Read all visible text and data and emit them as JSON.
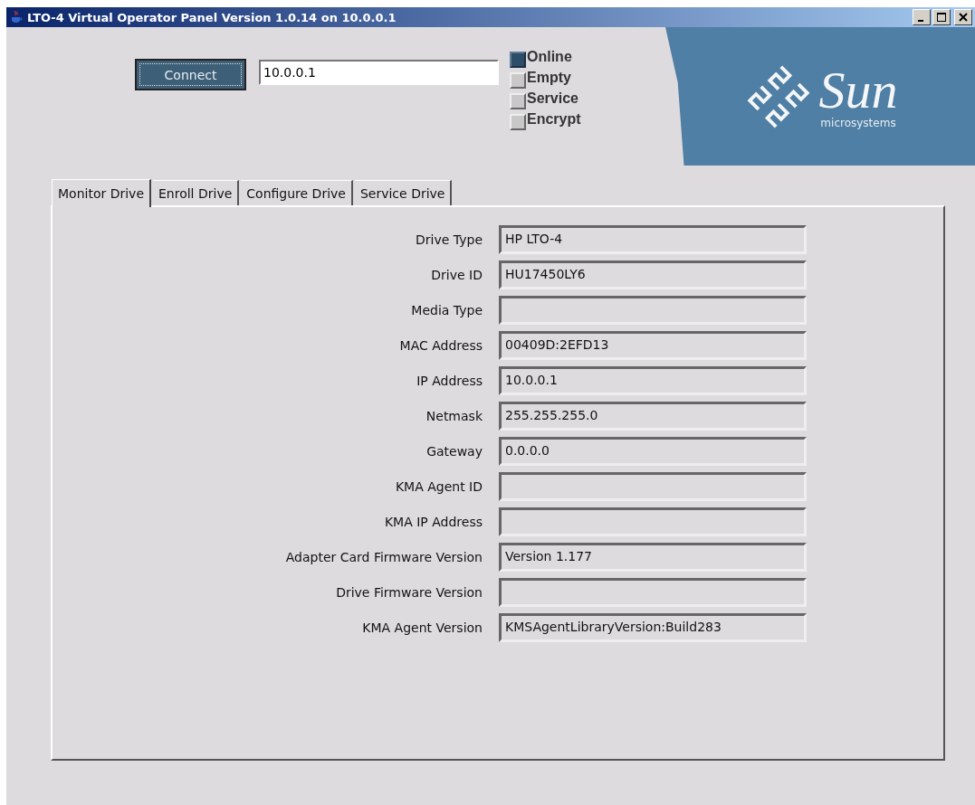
{
  "window": {
    "title": "LTO-4 Virtual Operator Panel Version 1.0.14 on 10.0.0.1"
  },
  "connect": {
    "button": "Connect",
    "address": "10.0.0.1"
  },
  "indicators": [
    {
      "label": "Online",
      "on": true
    },
    {
      "label": "Empty",
      "on": false
    },
    {
      "label": "Service",
      "on": false
    },
    {
      "label": "Encrypt",
      "on": false
    }
  ],
  "logo": {
    "name": "Sun",
    "tagline": "microsystems"
  },
  "tabs": [
    {
      "label": "Monitor Drive",
      "selected": true
    },
    {
      "label": "Enroll Drive",
      "selected": false
    },
    {
      "label": "Configure Drive",
      "selected": false
    },
    {
      "label": "Service Drive",
      "selected": false
    }
  ],
  "fields": [
    {
      "label": "Drive Type",
      "value": "HP LTO-4"
    },
    {
      "label": "Drive ID",
      "value": "HU17450LY6"
    },
    {
      "label": "Media Type"
    },
    {
      "label": "MAC Address",
      "value": "00409D:2EFD13"
    },
    {
      "label": "IP Address",
      "value": "10.0.0.1"
    },
    {
      "label": "Netmask",
      "value": "255.255.255.0"
    },
    {
      "label": "Gateway",
      "value": "0.0.0.0"
    },
    {
      "label": "KMA Agent ID"
    },
    {
      "label": "KMA IP Address"
    },
    {
      "label": "Adapter Card Firmware Version",
      "value": "Version 1.177"
    },
    {
      "label": "Drive Firmware Version"
    },
    {
      "label": "KMA Agent Version",
      "value": "KMSAgentLibraryVersion:Build283"
    }
  ]
}
